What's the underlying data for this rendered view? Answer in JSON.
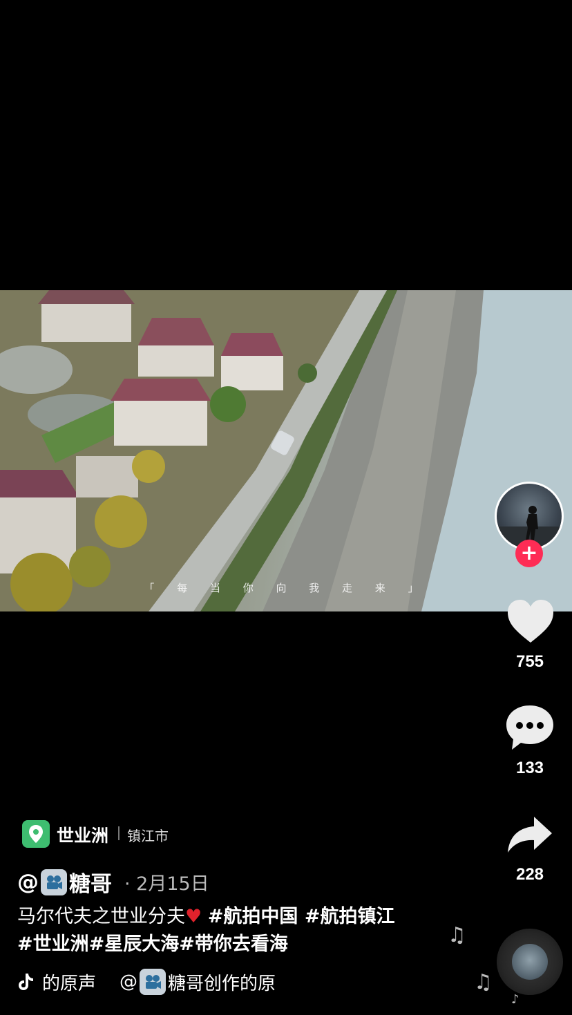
{
  "video": {
    "subtitle": "「 每 当 你 向 我 走 来 」"
  },
  "actions": {
    "likes": "755",
    "comments": "133",
    "shares": "228"
  },
  "location": {
    "name": "世业洲",
    "city": "镇江市"
  },
  "post": {
    "at_sign": "@",
    "author": "糖哥",
    "date": "· 2月15日",
    "description_prefix": "马尔代夫之世业分夫",
    "hashtags_line1": "#航拍中国 #航拍镇江",
    "hashtags_line2": "#世业洲#星辰大海#带你去看海"
  },
  "music": {
    "original_sound": "的原声",
    "creator_prefix": "@",
    "creator_suffix": "糖哥创作的原"
  },
  "colors": {
    "follow": "#fe2c55",
    "location_badge": "#3ebd70",
    "heart_emoji": "#e0222c"
  },
  "icons": [
    "location-pin-icon",
    "plus-icon",
    "heart-icon",
    "comment-icon",
    "share-icon",
    "tiktok-note-icon",
    "music-note-icon",
    "camera-badge-icon",
    "music-disc-icon"
  ]
}
